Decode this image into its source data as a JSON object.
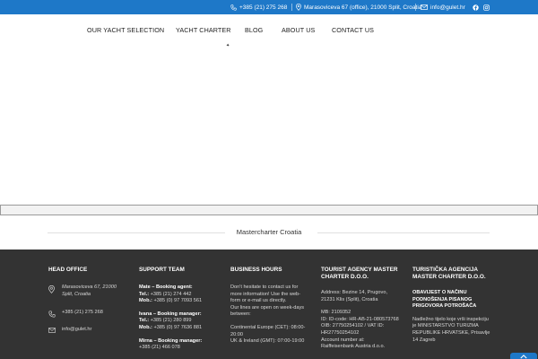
{
  "topbar": {
    "phone": "+385 (21) 275 268",
    "address": "Marasoviceva 67 (office), 21000 Split, Croatia",
    "email": "info@gulet.hr",
    "bg_color": "#1e78c8"
  },
  "nav": {
    "items": [
      {
        "label": "OUR YACHT SELECTION"
      },
      {
        "label": "YACHT CHARTER"
      },
      {
        "label": "BLOG"
      },
      {
        "label": "ABOUT US"
      },
      {
        "label": "CONTACT US"
      }
    ],
    "dropdown_glyph": "✦"
  },
  "divider": {
    "title": "Mastercharter Croatia"
  },
  "footer": {
    "head_office": {
      "title": "HEAD OFFICE",
      "address_line1": "Marasoviceva 67, 21000",
      "address_line2": "Split, Croatia",
      "phone": "+385 (21) 275 268",
      "email": "info@gulet.hr"
    },
    "support": {
      "title": "SUPPORT TEAM",
      "agents": [
        {
          "name": "Mate – Booking agent:",
          "tel_label": "Tel.:",
          "tel": "+385 (21) 274 442",
          "mob_label": "Mob.:",
          "mob": "+385 (0) 97 7093 561"
        },
        {
          "name": "Ivana – Booking manager:",
          "tel_label": "Tel.:",
          "tel": "+385 (21) 280 899",
          "mob_label": "Mob.:",
          "mob": "+385 (0) 97 7636 881"
        },
        {
          "name": "Mirna – Booking manager:",
          "tel_label": "",
          "tel": "+385 (21) 466 078",
          "mob_label": "",
          "mob": ""
        }
      ]
    },
    "hours": {
      "title": "BUSINESS HOURS",
      "line1": "Don't hesitate to contact us for",
      "line2": "more information! Use the web-",
      "line3": "form or e-mail us directly.",
      "line4": "Our lines are open on week-days",
      "line5": "between:",
      "line6": "Continental Europe (CET): 08:00-",
      "line7": "20:00",
      "line8": "UK & Ireland (GMT): 07:00-19:00"
    },
    "agency": {
      "title_line1": "TOURIST AGENCY MASTER",
      "title_line2": "CHARTER D.O.O.",
      "address1": "Address: Bezine 14, Prugovo,",
      "address2": "21231 Klis (Split), Croatia",
      "mb": "MB: 2109352",
      "id1": "ID: ID-code: HR-AB-21-080573768",
      "oib1": "OIB: 27750254102 / VAT ID:",
      "oib2": "HR27750254102",
      "account": "Account number at:",
      "bank": "Raiffeisenbank Austria d.o.o."
    },
    "agencija": {
      "title_line1": "TURISTIČKA AGENCIJA",
      "title_line2": "MASTER CHARTER D.O.O.",
      "notice1": "OBAVIJEST O NAČINU",
      "notice2": "PODNOŠENJA PISANOG",
      "notice3": "PRIGOVORA POTROŠAČA",
      "body1": "Nadležno tijelo koje vrši inspekciju",
      "body2": "je MINISTARSTVO TURIZMA",
      "body3": "REPUBLIKE HRVATSKE, Prisavlje",
      "body4": "14 Zagreb"
    },
    "bg_color": "#333333"
  }
}
